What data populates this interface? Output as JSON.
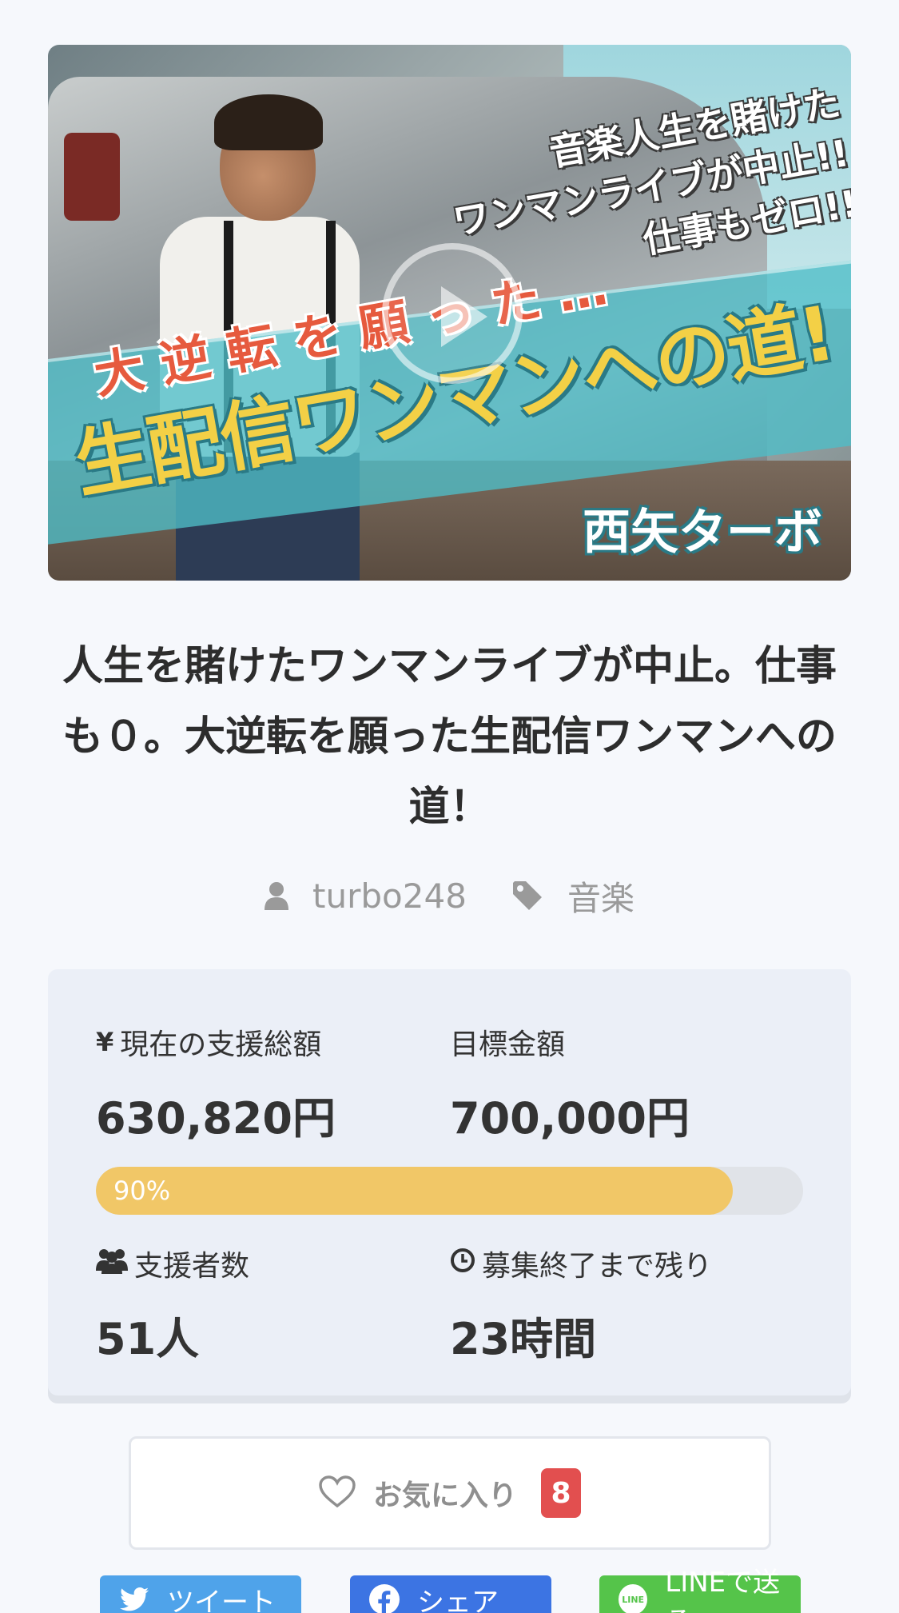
{
  "hero": {
    "overlay_top_lines": [
      "音楽人生を賭けた",
      "ワンマンライブが中止!!",
      "仕事もゼロ!!"
    ],
    "overlay_sub": "大逆転を願った…",
    "overlay_main": "生配信ワンマンへの道!",
    "overlay_name": "西矢ターボ",
    "play_icon": "play-icon"
  },
  "project": {
    "title": "人生を賭けたワンマンライブが中止。仕事も０。大逆転を願った生配信ワンマンへの道！",
    "author": "turbo248",
    "category": "音楽"
  },
  "stats": {
    "raised_label": "現在の支援総額",
    "raised_value": "630,820円",
    "goal_label": "目標金額",
    "goal_value": "700,000円",
    "progress_text": "90%",
    "progress_fraction": 0.9,
    "backers_label": "支援者数",
    "backers_value": "51人",
    "remaining_label": "募集終了まで残り",
    "remaining_value": "23時間",
    "yen_symbol": "¥"
  },
  "favorite": {
    "label": "お気に入り",
    "count": "8"
  },
  "share": {
    "twitter_label": "ツイート",
    "facebook_label": "シェア",
    "line_label": "LINEで送る",
    "line_icon_text": "LINE"
  },
  "colors": {
    "progress_fill": "#f1c767",
    "badge": "#e24f4f",
    "twitter": "#4fa3ea",
    "facebook": "#3c74e3",
    "line": "#55c44a"
  }
}
